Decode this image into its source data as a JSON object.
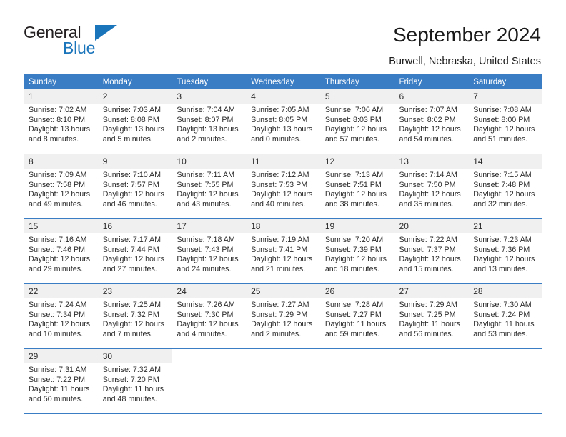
{
  "brand": {
    "line1": "General",
    "line2": "Blue",
    "accent_color": "#1b75bb"
  },
  "header": {
    "title": "September 2024",
    "location": "Burwell, Nebraska, United States"
  },
  "theme": {
    "header_row_bg": "#3b7dc4",
    "daynum_bg": "#f0f0f0",
    "grid_line": "#3b7dc4",
    "text": "#2b2b2b"
  },
  "calendar": {
    "weekday_headers": [
      "Sunday",
      "Monday",
      "Tuesday",
      "Wednesday",
      "Thursday",
      "Friday",
      "Saturday"
    ],
    "weeks": [
      [
        {
          "day": "1",
          "sunrise": "Sunrise: 7:02 AM",
          "sunset": "Sunset: 8:10 PM",
          "daylight": "Daylight: 13 hours and 8 minutes."
        },
        {
          "day": "2",
          "sunrise": "Sunrise: 7:03 AM",
          "sunset": "Sunset: 8:08 PM",
          "daylight": "Daylight: 13 hours and 5 minutes."
        },
        {
          "day": "3",
          "sunrise": "Sunrise: 7:04 AM",
          "sunset": "Sunset: 8:07 PM",
          "daylight": "Daylight: 13 hours and 2 minutes."
        },
        {
          "day": "4",
          "sunrise": "Sunrise: 7:05 AM",
          "sunset": "Sunset: 8:05 PM",
          "daylight": "Daylight: 13 hours and 0 minutes."
        },
        {
          "day": "5",
          "sunrise": "Sunrise: 7:06 AM",
          "sunset": "Sunset: 8:03 PM",
          "daylight": "Daylight: 12 hours and 57 minutes."
        },
        {
          "day": "6",
          "sunrise": "Sunrise: 7:07 AM",
          "sunset": "Sunset: 8:02 PM",
          "daylight": "Daylight: 12 hours and 54 minutes."
        },
        {
          "day": "7",
          "sunrise": "Sunrise: 7:08 AM",
          "sunset": "Sunset: 8:00 PM",
          "daylight": "Daylight: 12 hours and 51 minutes."
        }
      ],
      [
        {
          "day": "8",
          "sunrise": "Sunrise: 7:09 AM",
          "sunset": "Sunset: 7:58 PM",
          "daylight": "Daylight: 12 hours and 49 minutes."
        },
        {
          "day": "9",
          "sunrise": "Sunrise: 7:10 AM",
          "sunset": "Sunset: 7:57 PM",
          "daylight": "Daylight: 12 hours and 46 minutes."
        },
        {
          "day": "10",
          "sunrise": "Sunrise: 7:11 AM",
          "sunset": "Sunset: 7:55 PM",
          "daylight": "Daylight: 12 hours and 43 minutes."
        },
        {
          "day": "11",
          "sunrise": "Sunrise: 7:12 AM",
          "sunset": "Sunset: 7:53 PM",
          "daylight": "Daylight: 12 hours and 40 minutes."
        },
        {
          "day": "12",
          "sunrise": "Sunrise: 7:13 AM",
          "sunset": "Sunset: 7:51 PM",
          "daylight": "Daylight: 12 hours and 38 minutes."
        },
        {
          "day": "13",
          "sunrise": "Sunrise: 7:14 AM",
          "sunset": "Sunset: 7:50 PM",
          "daylight": "Daylight: 12 hours and 35 minutes."
        },
        {
          "day": "14",
          "sunrise": "Sunrise: 7:15 AM",
          "sunset": "Sunset: 7:48 PM",
          "daylight": "Daylight: 12 hours and 32 minutes."
        }
      ],
      [
        {
          "day": "15",
          "sunrise": "Sunrise: 7:16 AM",
          "sunset": "Sunset: 7:46 PM",
          "daylight": "Daylight: 12 hours and 29 minutes."
        },
        {
          "day": "16",
          "sunrise": "Sunrise: 7:17 AM",
          "sunset": "Sunset: 7:44 PM",
          "daylight": "Daylight: 12 hours and 27 minutes."
        },
        {
          "day": "17",
          "sunrise": "Sunrise: 7:18 AM",
          "sunset": "Sunset: 7:43 PM",
          "daylight": "Daylight: 12 hours and 24 minutes."
        },
        {
          "day": "18",
          "sunrise": "Sunrise: 7:19 AM",
          "sunset": "Sunset: 7:41 PM",
          "daylight": "Daylight: 12 hours and 21 minutes."
        },
        {
          "day": "19",
          "sunrise": "Sunrise: 7:20 AM",
          "sunset": "Sunset: 7:39 PM",
          "daylight": "Daylight: 12 hours and 18 minutes."
        },
        {
          "day": "20",
          "sunrise": "Sunrise: 7:22 AM",
          "sunset": "Sunset: 7:37 PM",
          "daylight": "Daylight: 12 hours and 15 minutes."
        },
        {
          "day": "21",
          "sunrise": "Sunrise: 7:23 AM",
          "sunset": "Sunset: 7:36 PM",
          "daylight": "Daylight: 12 hours and 13 minutes."
        }
      ],
      [
        {
          "day": "22",
          "sunrise": "Sunrise: 7:24 AM",
          "sunset": "Sunset: 7:34 PM",
          "daylight": "Daylight: 12 hours and 10 minutes."
        },
        {
          "day": "23",
          "sunrise": "Sunrise: 7:25 AM",
          "sunset": "Sunset: 7:32 PM",
          "daylight": "Daylight: 12 hours and 7 minutes."
        },
        {
          "day": "24",
          "sunrise": "Sunrise: 7:26 AM",
          "sunset": "Sunset: 7:30 PM",
          "daylight": "Daylight: 12 hours and 4 minutes."
        },
        {
          "day": "25",
          "sunrise": "Sunrise: 7:27 AM",
          "sunset": "Sunset: 7:29 PM",
          "daylight": "Daylight: 12 hours and 2 minutes."
        },
        {
          "day": "26",
          "sunrise": "Sunrise: 7:28 AM",
          "sunset": "Sunset: 7:27 PM",
          "daylight": "Daylight: 11 hours and 59 minutes."
        },
        {
          "day": "27",
          "sunrise": "Sunrise: 7:29 AM",
          "sunset": "Sunset: 7:25 PM",
          "daylight": "Daylight: 11 hours and 56 minutes."
        },
        {
          "day": "28",
          "sunrise": "Sunrise: 7:30 AM",
          "sunset": "Sunset: 7:24 PM",
          "daylight": "Daylight: 11 hours and 53 minutes."
        }
      ],
      [
        {
          "day": "29",
          "sunrise": "Sunrise: 7:31 AM",
          "sunset": "Sunset: 7:22 PM",
          "daylight": "Daylight: 11 hours and 50 minutes."
        },
        {
          "day": "30",
          "sunrise": "Sunrise: 7:32 AM",
          "sunset": "Sunset: 7:20 PM",
          "daylight": "Daylight: 11 hours and 48 minutes."
        },
        {
          "day": "",
          "sunrise": "",
          "sunset": "",
          "daylight": ""
        },
        {
          "day": "",
          "sunrise": "",
          "sunset": "",
          "daylight": ""
        },
        {
          "day": "",
          "sunrise": "",
          "sunset": "",
          "daylight": ""
        },
        {
          "day": "",
          "sunrise": "",
          "sunset": "",
          "daylight": ""
        },
        {
          "day": "",
          "sunrise": "",
          "sunset": "",
          "daylight": ""
        }
      ]
    ]
  }
}
